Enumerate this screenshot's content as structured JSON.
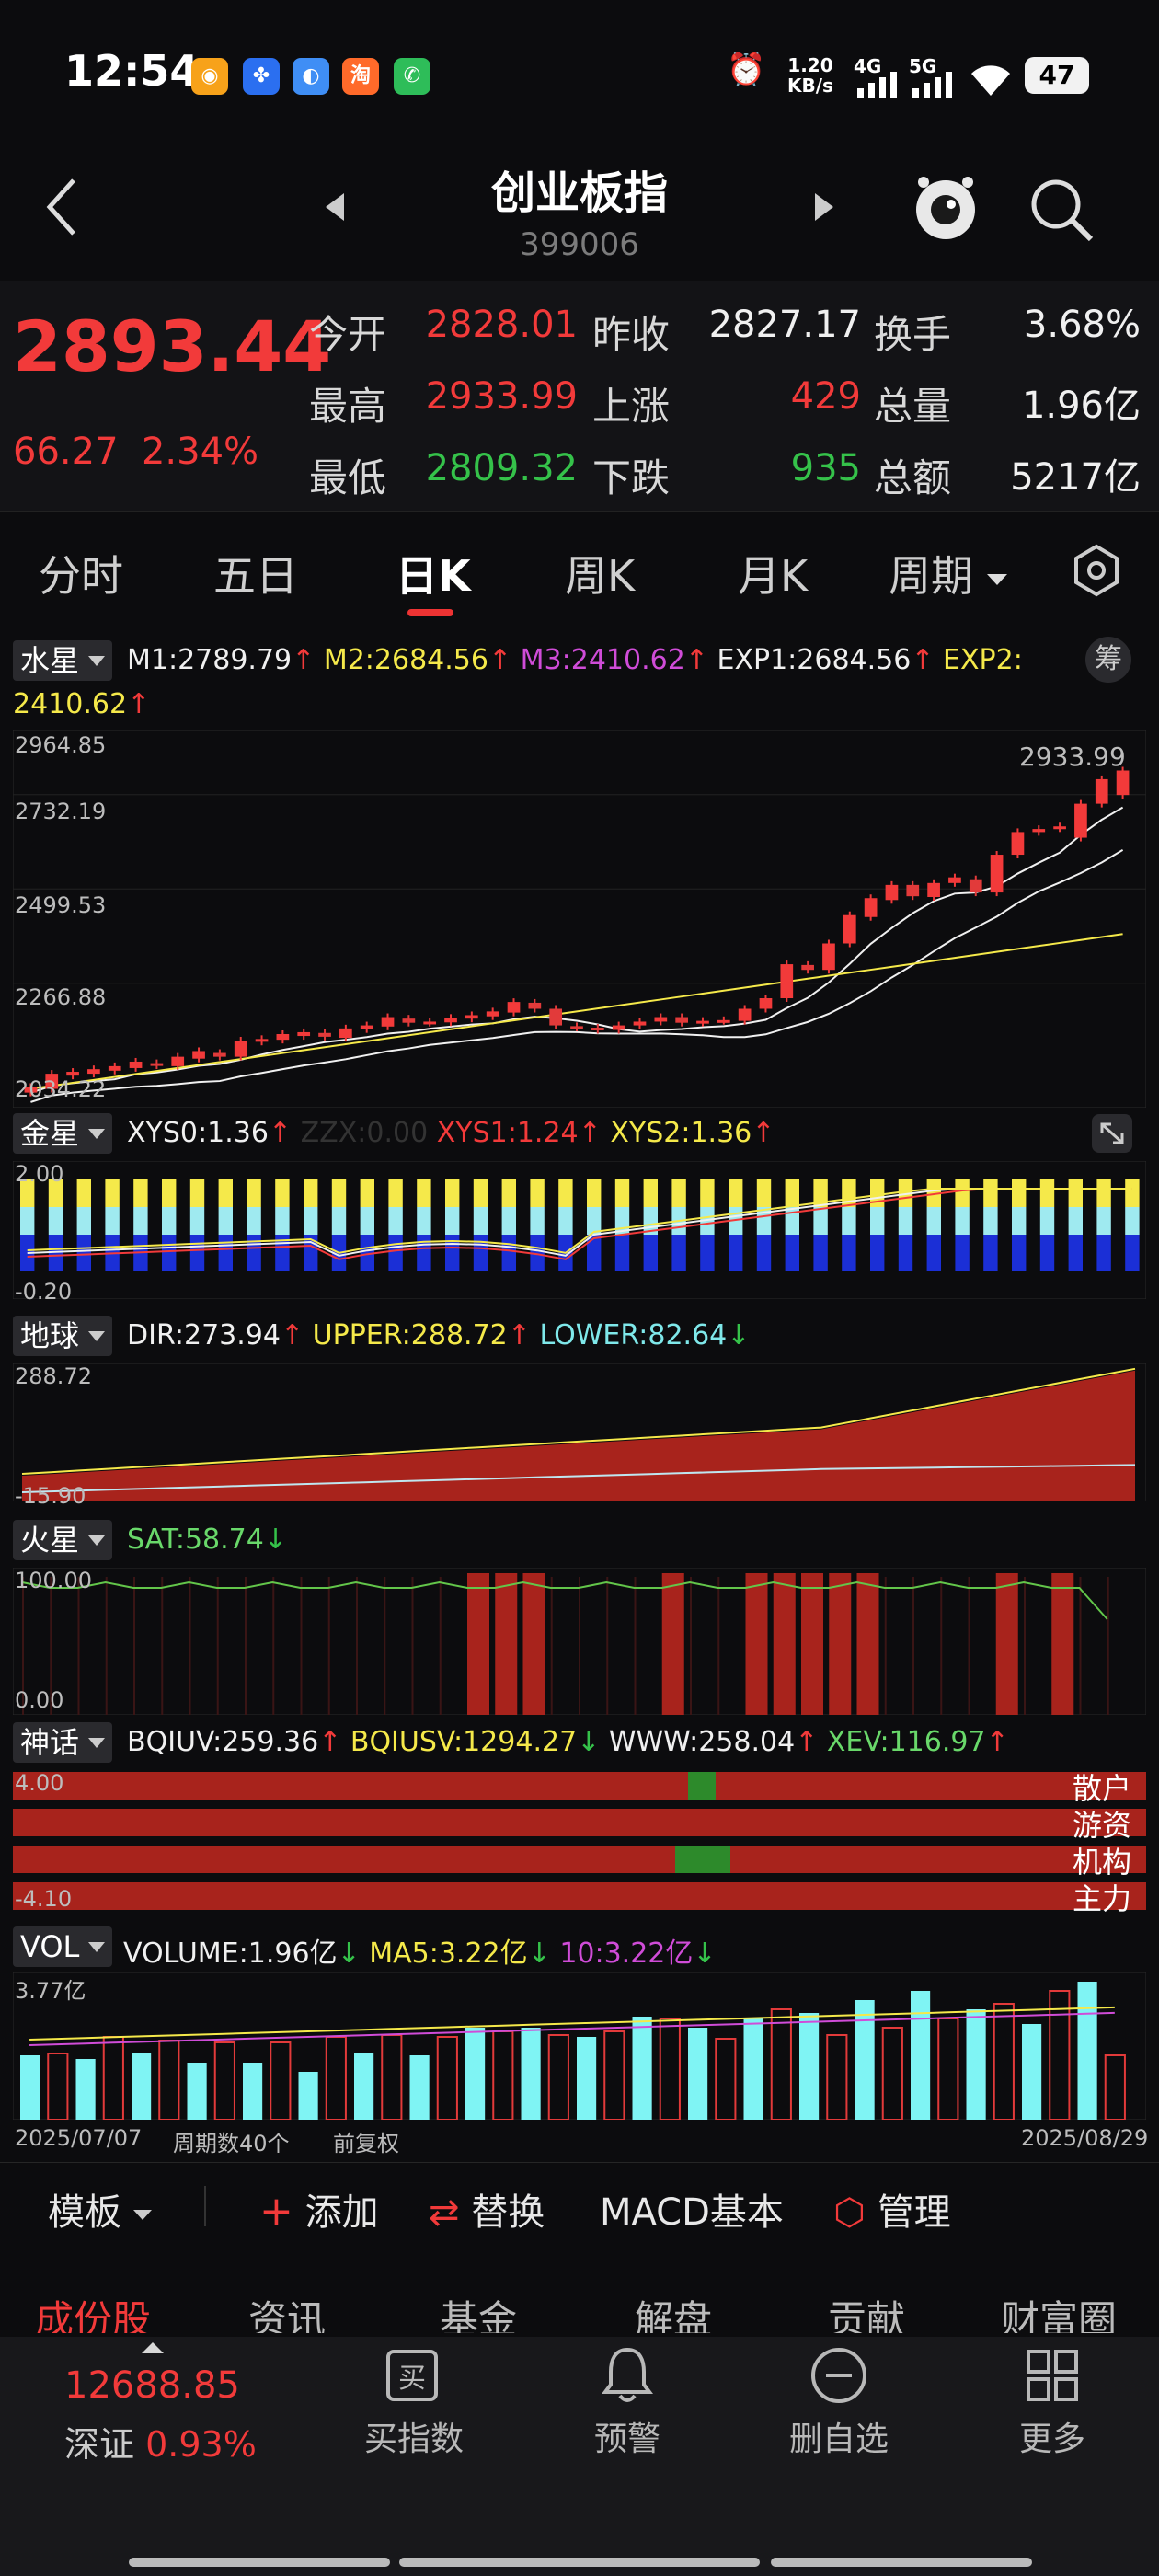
{
  "status": {
    "time": "12:54",
    "network_speed_value": "1.20",
    "network_speed_unit": "KB/s",
    "net1": "4G",
    "net2": "5G",
    "battery": "47",
    "icons": [
      "weibo-icon",
      "baidu-icon",
      "app-icon",
      "taobao-icon",
      "phone-icon",
      "alarm-icon",
      "signal-icon",
      "wifi-icon"
    ]
  },
  "header": {
    "title": "创业板指",
    "code": "399006"
  },
  "quote": {
    "price": "2893.44",
    "change": "66.27",
    "change_pct": "2.34%",
    "open_label": "今开",
    "open": "2828.01",
    "prev_close_label": "昨收",
    "prev_close": "2827.17",
    "turnover_label": "换手",
    "turnover": "3.68%",
    "high_label": "最高",
    "high": "2933.99",
    "up_label": "上涨",
    "up": "429",
    "volume_label": "总量",
    "volume": "1.96亿",
    "low_label": "最低",
    "low": "2809.32",
    "down_label": "下跌",
    "down": "935",
    "amount_label": "总额",
    "amount": "5217亿"
  },
  "tabs": [
    "分时",
    "五日",
    "日K",
    "周K",
    "月K",
    "周期"
  ],
  "active_tab": "日K",
  "main_chart": {
    "selector": "水星",
    "m1_label": "M1:",
    "m1": "2789.79",
    "m2_label": "M2:",
    "m2": "2684.56",
    "m3_label": "M3:",
    "m3": "2410.62",
    "exp1_label": "EXP1:",
    "exp1": "2684.56",
    "exp2_label": "EXP2:",
    "exp2": "2410.62",
    "chip_button": "筹",
    "y_ticks": [
      "2964.85",
      "2732.19",
      "2499.53",
      "2266.88",
      "2034.22"
    ],
    "high_marker": "2933.99"
  },
  "chart_data": {
    "type": "candlestick",
    "title": "",
    "y_range": [
      2034.22,
      2964.85
    ],
    "x_start": "2025/07/07",
    "x_end": "2025/08/29",
    "period_count_label": "周期数40个",
    "adjust_label": "前复权",
    "candles": [
      {
        "o": 2040,
        "c": 2055
      },
      {
        "o": 2050,
        "c": 2090
      },
      {
        "o": 2085,
        "c": 2095
      },
      {
        "o": 2090,
        "c": 2102
      },
      {
        "o": 2098,
        "c": 2110
      },
      {
        "o": 2105,
        "c": 2122
      },
      {
        "o": 2118,
        "c": 2112
      },
      {
        "o": 2110,
        "c": 2135
      },
      {
        "o": 2130,
        "c": 2150
      },
      {
        "o": 2145,
        "c": 2135
      },
      {
        "o": 2135,
        "c": 2178
      },
      {
        "o": 2175,
        "c": 2182
      },
      {
        "o": 2180,
        "c": 2195
      },
      {
        "o": 2190,
        "c": 2200
      },
      {
        "o": 2198,
        "c": 2188
      },
      {
        "o": 2185,
        "c": 2210
      },
      {
        "o": 2208,
        "c": 2218
      },
      {
        "o": 2215,
        "c": 2240
      },
      {
        "o": 2236,
        "c": 2225
      },
      {
        "o": 2225,
        "c": 2228
      },
      {
        "o": 2226,
        "c": 2238
      },
      {
        "o": 2236,
        "c": 2245
      },
      {
        "o": 2242,
        "c": 2255
      },
      {
        "o": 2252,
        "c": 2280
      },
      {
        "o": 2278,
        "c": 2262
      },
      {
        "o": 2262,
        "c": 2218
      },
      {
        "o": 2216,
        "c": 2212
      },
      {
        "o": 2212,
        "c": 2206
      },
      {
        "o": 2206,
        "c": 2218
      },
      {
        "o": 2218,
        "c": 2228
      },
      {
        "o": 2228,
        "c": 2240
      },
      {
        "o": 2240,
        "c": 2225
      },
      {
        "o": 2225,
        "c": 2230
      },
      {
        "o": 2230,
        "c": 2232
      },
      {
        "o": 2230,
        "c": 2262
      },
      {
        "o": 2262,
        "c": 2290
      },
      {
        "o": 2290,
        "c": 2380
      },
      {
        "o": 2378,
        "c": 2365
      },
      {
        "o": 2365,
        "c": 2435
      },
      {
        "o": 2435,
        "c": 2510
      },
      {
        "o": 2505,
        "c": 2555
      },
      {
        "o": 2550,
        "c": 2590
      },
      {
        "o": 2590,
        "c": 2560
      },
      {
        "o": 2558,
        "c": 2595
      },
      {
        "o": 2595,
        "c": 2610
      },
      {
        "o": 2605,
        "c": 2570
      },
      {
        "o": 2570,
        "c": 2670
      },
      {
        "o": 2670,
        "c": 2730
      },
      {
        "o": 2730,
        "c": 2738
      },
      {
        "o": 2740,
        "c": 2745
      },
      {
        "o": 2715,
        "c": 2805
      },
      {
        "o": 2805,
        "c": 2870
      },
      {
        "o": 2828,
        "c": 2893
      }
    ]
  },
  "jinxing": {
    "selector": "金星",
    "xys0_label": "XYS0:",
    "xys0": "1.36",
    "zzx_label": "ZZX:",
    "zzx": "0.00",
    "xys1_label": "XYS1:",
    "xys1": "1.24",
    "xys2_label": "XYS2:",
    "xys2": "1.36",
    "y_top": "2.00",
    "y_bottom": "-0.20"
  },
  "diqiu": {
    "selector": "地球",
    "dir_label": "DIR:",
    "dir": "273.94",
    "upper_label": "UPPER:",
    "upper": "288.72",
    "lower_label": "LOWER:",
    "lower": "82.64",
    "y_top": "288.72",
    "y_bottom": "-15.90"
  },
  "huoxing": {
    "selector": "火星",
    "sat_label": "SAT:",
    "sat": "58.74",
    "y_top": "100.00",
    "y_bottom": "0.00"
  },
  "shenhua": {
    "selector": "神话",
    "bqiuv_label": "BQIUV:",
    "bqiuv": "259.36",
    "bqiusv_label": "BQIUSV:",
    "bqiusv": "1294.27",
    "www_label": "WWW:",
    "www": "258.04",
    "xev_label": "XEV:",
    "xev": "116.97",
    "y_top": "4.00",
    "y_bottom": "-4.10",
    "rows": [
      "散户",
      "游资",
      "机构",
      "主力"
    ]
  },
  "vol": {
    "selector": "VOL",
    "volume_label": "VOLUME:",
    "volume": "1.96亿",
    "ma5_label": "MA5:",
    "ma5": "3.22亿",
    "ma10_label": "10:",
    "ma10": "3.22亿",
    "y_top": "3.77亿"
  },
  "toolbar": {
    "template": "模板",
    "add": "添加",
    "replace": "替换",
    "macd": "MACD基本",
    "manage": "管理"
  },
  "segments": [
    "成份股",
    "资讯",
    "基金",
    "解盘",
    "贡献",
    "财富圈"
  ],
  "bottom": {
    "sz_value": "12688.85",
    "sz_label": "深证",
    "sz_pct": "0.93%",
    "buy": "买指数",
    "alert": "预警",
    "remove": "删自选",
    "more": "更多",
    "buy_icon_char": "买"
  },
  "colors": {
    "up": "#f23a3a",
    "down": "#35c24a",
    "bg": "#0c0c0e",
    "accent": "#e33333"
  }
}
